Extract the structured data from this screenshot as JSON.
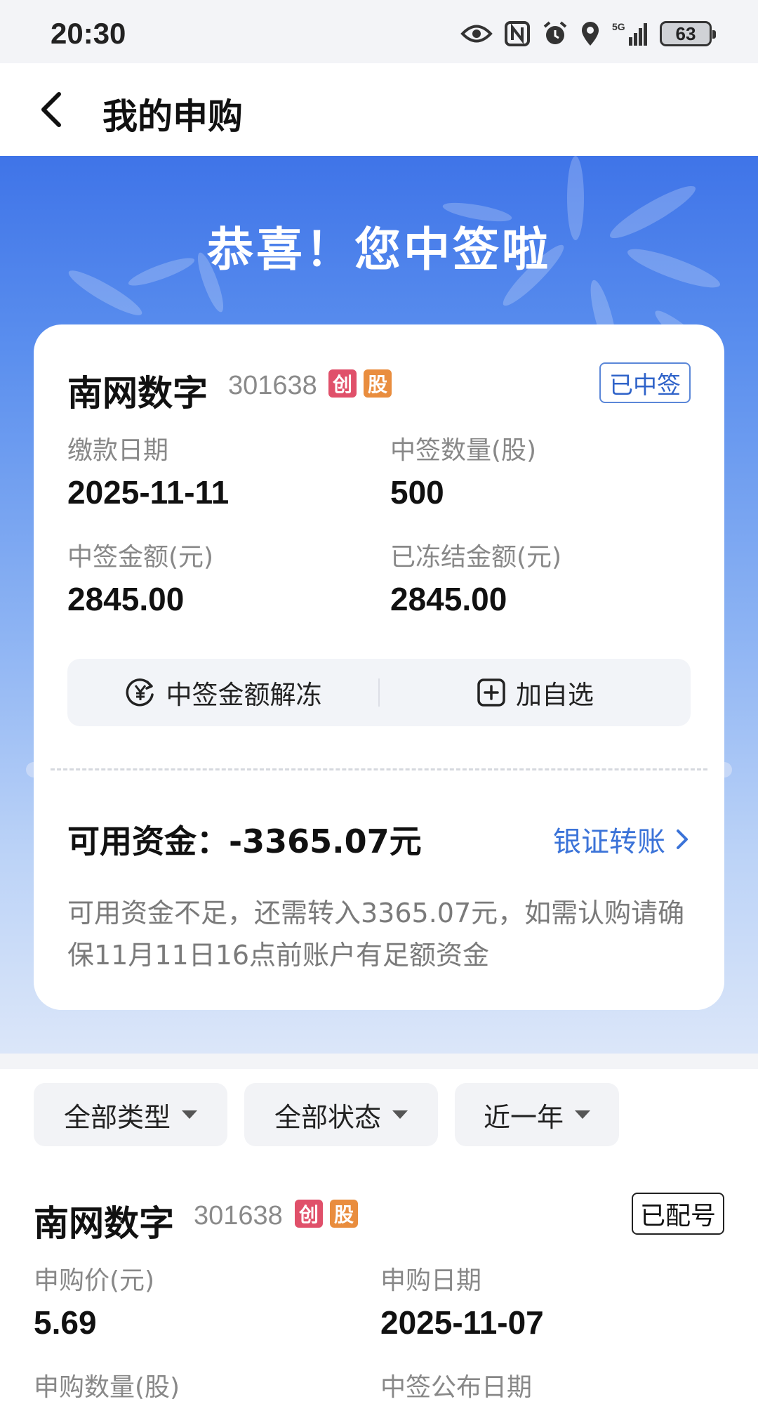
{
  "status_bar": {
    "time": "20:30",
    "battery": "63",
    "network": "5G"
  },
  "header": {
    "title": "我的申购"
  },
  "hero": {
    "title": "恭喜！您中签啦"
  },
  "card": {
    "stock_name": "南网数字",
    "stock_code": "301638",
    "tags": [
      "创",
      "股"
    ],
    "status": "已中签",
    "fields": [
      {
        "label": "缴款日期",
        "value": "2025-11-11"
      },
      {
        "label": "中签数量(股)",
        "value": "500"
      },
      {
        "label": "中签金额(元)",
        "value": "2845.00"
      },
      {
        "label": "已冻结金额(元)",
        "value": "2845.00"
      }
    ],
    "actions": {
      "unfreeze": "中签金额解冻",
      "add_watchlist": "加自选"
    },
    "funds_label": "可用资金：-3365.07元",
    "transfer_link": "银证转账",
    "funds_note": "可用资金不足，还需转入3365.07元，如需认购请确保11月11日16点前账户有足额资金"
  },
  "filters": [
    "全部类型",
    "全部状态",
    "近一年"
  ],
  "list_item": {
    "stock_name": "南网数字",
    "stock_code": "301638",
    "tags": [
      "创",
      "股"
    ],
    "status": "已配号",
    "fields": [
      {
        "label": "申购价(元)",
        "value": "5.69"
      },
      {
        "label": "申购日期",
        "value": "2025-11-07"
      },
      {
        "label": "申购数量(股)",
        "value": ""
      },
      {
        "label": "中签公布日期",
        "value": ""
      }
    ]
  },
  "colors": {
    "accent": "#3b73d8",
    "hero_top": "#3f74e8",
    "tag_chuang": "#e0506a",
    "tag_gu": "#e98d3e"
  }
}
